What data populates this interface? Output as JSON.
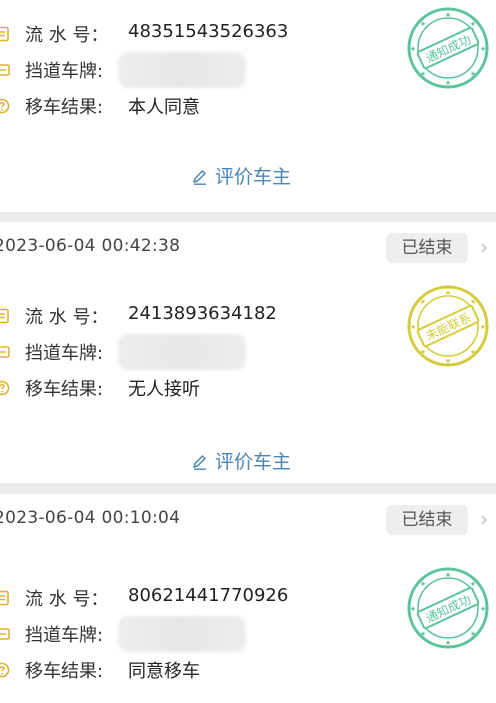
{
  "status_closed": "已结束",
  "labels": {
    "serial": "流 水 号：",
    "plate": "挡道车牌:",
    "result": "移车结果:"
  },
  "evaluate_label": "评价车主",
  "records": [
    {
      "serial": "48351543526363",
      "result": "本人同意",
      "stamp": "通知成功",
      "stamp_color": "#5cc49a"
    },
    {
      "time": "2023-06-04 00:42:38",
      "serial": "2413893634182",
      "result": "无人接听",
      "stamp": "未能联系",
      "stamp_color": "#d4cc3c"
    },
    {
      "time": "2023-06-04 00:10:04",
      "serial": "80621441770926",
      "result": "同意移车",
      "stamp": "通知成功",
      "stamp_color": "#5cc49a"
    }
  ],
  "icons": {
    "serial": "receipt-icon",
    "plate": "license-plate-icon",
    "result": "question-circle-icon",
    "evaluate": "pencil-icon",
    "status": "chevron-right-icon"
  },
  "colors": {
    "accent": "#4a86b6",
    "icon": "#e0b030"
  }
}
